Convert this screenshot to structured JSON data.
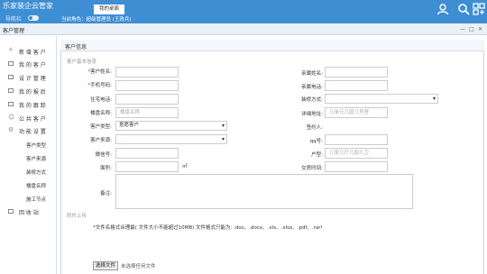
{
  "app": {
    "title": "乐家装企云管家"
  },
  "topbar": {
    "nav_label": "导航栏",
    "role_text": "当前角色：超级管理员 (王政兵)",
    "tab_desktop": "我的桌面"
  },
  "subbar": {
    "title": "客户管理"
  },
  "sidebar": {
    "items": [
      {
        "label": "新 增 客 户"
      },
      {
        "label": "我 的 客 户"
      },
      {
        "label": "设 计 管 理"
      },
      {
        "label": "我 的 报 后"
      },
      {
        "label": "我 的 跟 踪"
      },
      {
        "label": "公 共 客 户"
      },
      {
        "label": "功 能 设 置"
      }
    ],
    "subitems": [
      {
        "label": "客户类型"
      },
      {
        "label": "客户来源"
      },
      {
        "label": "装修方式"
      },
      {
        "label": "楼盘名称"
      },
      {
        "label": "施工节点"
      }
    ],
    "recycle": "回 收 站"
  },
  "panel": {
    "title": "客户信息",
    "section_basic": "客户基本信息",
    "section_attach": "附件上传"
  },
  "form": {
    "customer_name": {
      "label": "客户姓名:",
      "required": true
    },
    "mobile": {
      "label": "手机号码:",
      "required": true
    },
    "home_phone": {
      "label": "住宅电话:"
    },
    "estate": {
      "label": "楼盘名称:",
      "placeholder": "楼盘名称"
    },
    "cust_type": {
      "label": "客户类型:",
      "value": "意愿客户"
    },
    "cust_source": {
      "label": "客户来源:"
    },
    "wechat": {
      "label": "微信号:"
    },
    "area": {
      "label": "面积:",
      "unit": "㎡"
    },
    "remark": {
      "label": "备注:"
    },
    "spouse_name": {
      "label": "亲属姓名:"
    },
    "spouse_phone": {
      "label": "亲属电话:"
    },
    "reno_type": {
      "label": "装修方式:"
    },
    "address": {
      "label": "详细地址:",
      "placeholder": "几单元几层几号室"
    },
    "signer": {
      "label": "签约人:"
    },
    "qq": {
      "label": "qq号:"
    },
    "house_type": {
      "label": "户型:",
      "placeholder": "几室几厅几厨几卫"
    },
    "delivery": {
      "label": "交房时间:"
    }
  },
  "attach": {
    "hint": "*文件名格式合理最( 文件大小不能超过10MB) 文件格式只能为: .doc、.docx、.xls、.xlsx、.pdf、.rar!",
    "choose_btn": "选择文件",
    "no_file": "未选择任何文件"
  }
}
